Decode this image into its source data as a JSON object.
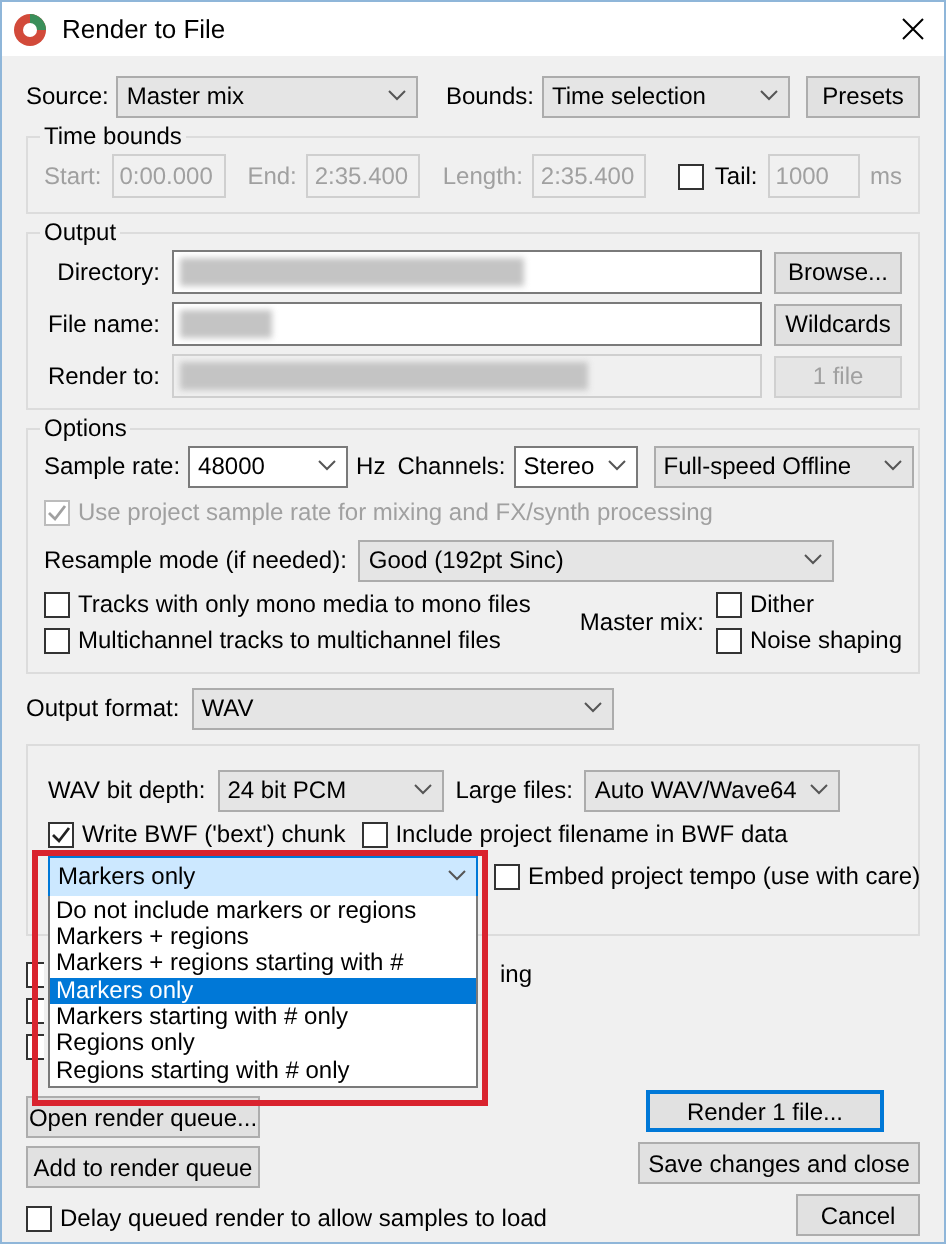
{
  "window": {
    "title": "Render to File"
  },
  "source": {
    "label": "Source:",
    "value": "Master mix"
  },
  "bounds": {
    "label": "Bounds:",
    "value": "Time selection"
  },
  "presets_button": "Presets",
  "time_bounds": {
    "title": "Time bounds",
    "disabled": true,
    "fields": [
      {
        "label": "Start:",
        "value": "0:00.000"
      },
      {
        "label": "End:",
        "value": "2:35.400"
      },
      {
        "label": "Length:",
        "value": "2:35.400"
      }
    ],
    "tail": {
      "label": "Tail:",
      "checked": false,
      "value": "1000",
      "unit": "ms"
    }
  },
  "output": {
    "title": "Output",
    "fields": [
      {
        "label": "Directory:",
        "redacted": true,
        "disabled": false,
        "button": "Browse..."
      },
      {
        "label": "File name:",
        "redacted": true,
        "disabled": false,
        "button": "Wildcards"
      },
      {
        "label": "Render to:",
        "redacted": true,
        "disabled": true,
        "button": "1 file"
      }
    ]
  },
  "options": {
    "title": "Options",
    "sample_rate": {
      "label": "Sample rate:",
      "value": "48000",
      "unit": "Hz"
    },
    "channels": {
      "label": "Channels:",
      "value": "Stereo"
    },
    "render_speed": {
      "value": "Full-speed Offline"
    },
    "project_rate": {
      "label": "Use project sample rate for mixing and FX/synth processing",
      "checked": true,
      "disabled": true
    },
    "resample": {
      "label": "Resample mode (if needed):",
      "value": "Good (192pt Sinc)"
    },
    "checkboxes": [
      {
        "label": "Tracks with only mono media to mono files",
        "checked": false
      },
      {
        "label": "Multichannel tracks to multichannel files",
        "checked": false
      }
    ],
    "master_mix": {
      "label": "Master mix:",
      "options": [
        {
          "label": "Dither",
          "checked": false
        },
        {
          "label": "Noise shaping",
          "checked": false
        }
      ]
    }
  },
  "output_format": {
    "label": "Output format:",
    "value": "WAV"
  },
  "format_options": {
    "bit_depth": {
      "label": "WAV bit depth:",
      "value": "24 bit PCM"
    },
    "large_files": {
      "label": "Large files:",
      "value": "Auto WAV/Wave64"
    },
    "checkboxes": [
      {
        "label": "Write BWF ('bext') chunk",
        "checked": true
      },
      {
        "label": "Include project filename in BWF data",
        "checked": false
      }
    ],
    "markers": {
      "value": "Markers only",
      "open": true,
      "options": [
        {
          "label": "Do not include markers or regions",
          "selected": false
        },
        {
          "label": "Markers + regions",
          "selected": false
        },
        {
          "label": "Markers + regions starting with #",
          "selected": false
        },
        {
          "label": "Markers only",
          "selected": true
        },
        {
          "label": "Markers starting with # only",
          "selected": false
        },
        {
          "label": "Regions only",
          "selected": false
        },
        {
          "label": "Regions starting with # only",
          "selected": false
        }
      ]
    },
    "embed_tempo": {
      "label": "Embed project tempo (use with care)",
      "checked": false
    }
  },
  "covered_rows": [
    {
      "kind": "checkbox",
      "visible_text": "ing"
    },
    {
      "kind": "checkbox"
    },
    {
      "kind": "checkbox"
    }
  ],
  "buttons": {
    "render": {
      "label": "Render 1 file...",
      "default": true
    },
    "open_queue": "Open render queue...",
    "add_queue": "Add to render queue",
    "save": "Save changes and close",
    "cancel": "Cancel"
  },
  "delay": {
    "label": "Delay queued render to allow samples to load",
    "checked": false
  },
  "annotation": {
    "kind": "frame",
    "color": "#d9232e"
  }
}
